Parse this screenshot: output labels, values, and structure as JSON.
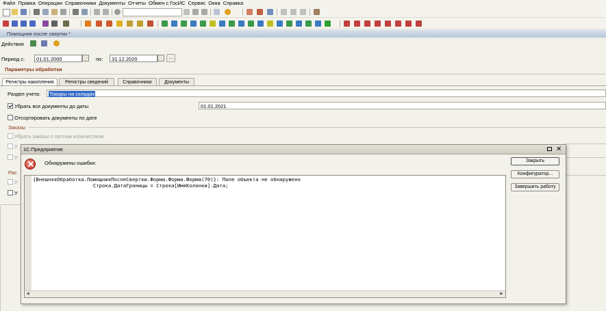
{
  "menu": [
    "Файл",
    "Правка",
    "Операции",
    "Справочники",
    "Документы",
    "Отчеты",
    "Обмен с ГосИС",
    "Сервис",
    "Окна",
    "Справка"
  ],
  "window": {
    "title": "Помощник после свертки *"
  },
  "actions": {
    "label": "Действия"
  },
  "period": {
    "from_label": "Период с:",
    "from_value": "01.01.2000",
    "to_label": "по:",
    "to_value": "31.12.2020",
    "ellipsis": "..."
  },
  "params_title": "Параметры обработки",
  "tabs": [
    "Регистры накопления",
    "Регистры сведений",
    "Справочники",
    "Документы"
  ],
  "section_label": "Раздел учета:",
  "section_value": "Товары на складах",
  "remove_docs": {
    "label": "Убрать все документы до даты",
    "checked": true,
    "date": "01.01.2021"
  },
  "sort_docs": {
    "label": "Отсортировать документы по дате",
    "checked": false
  },
  "orders_group": "Заказы",
  "orders_remove_empty": "Убрать заказы с пустым количеством",
  "partial_a": "У",
  "partial_b": "У",
  "partial_c": "Рас",
  "partial_d": "У",
  "partial_e": "У",
  "dialog": {
    "title": "1С:Предприятие",
    "message": "Обнаружены ошибки:",
    "buttons": {
      "close": "Закрыть",
      "configurator": "Конфигуратор...",
      "exit": "Завершить работу"
    },
    "error_text": "{ВнешняяОбработка.ПомощникПослеСвертки.Форма.Форма.Форма(70)}: Поле объекта не обнаружено\n                    Строка.ДатаГраницы = Строка[ИмяКолонки].Дата;"
  },
  "colors": {
    "accent_title": "#8a3a1a",
    "selection": "#316ac5",
    "error_red": "#c0281a"
  }
}
